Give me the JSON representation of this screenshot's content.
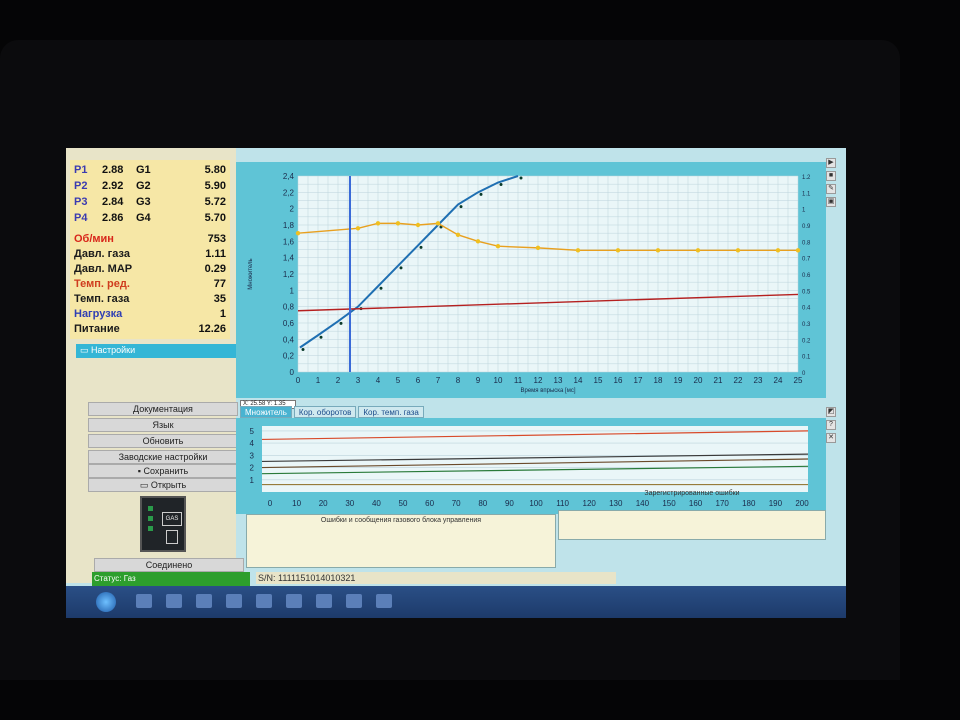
{
  "params": {
    "injectors": [
      {
        "label": "P1",
        "pressure": "2.88",
        "gas": "G1",
        "value": "5.80"
      },
      {
        "label": "P2",
        "pressure": "2.92",
        "gas": "G2",
        "value": "5.90"
      },
      {
        "label": "P3",
        "pressure": "2.84",
        "gas": "G3",
        "value": "5.72"
      },
      {
        "label": "P4",
        "pressure": "2.86",
        "gas": "G4",
        "value": "5.70"
      }
    ],
    "sensors": [
      {
        "label": "Об/мин",
        "value": "753",
        "color": "#d8261a"
      },
      {
        "label": "Давл. газа",
        "value": "1.11",
        "color": "#1b1b1b"
      },
      {
        "label": "Давл. MAP",
        "value": "0.29",
        "color": "#1b1b1b"
      },
      {
        "label": "Темп. ред.",
        "value": "77",
        "color": "#cf3d1f"
      },
      {
        "label": "Темп. газа",
        "value": "35",
        "color": "#1b1b1b"
      },
      {
        "label": "Нагрузка",
        "value": "1",
        "color": "#2f3fb3"
      },
      {
        "label": "Питание",
        "value": "12.26",
        "color": "#1b1b1b"
      }
    ]
  },
  "sidebar": {
    "settings_header": "Настройки",
    "buttons": [
      "Документация",
      "Язык",
      "Обновить",
      "Заводские настройки",
      "Сохранить",
      "Открыть"
    ],
    "device_label": "GAS",
    "connect_label": "Соединено"
  },
  "chart": {
    "coord_readout": "X: 25.58  Y: 1.35",
    "xlabel": "Время впрыска [мс]",
    "ylabel": "Множитель",
    "x_ticks": [
      "0",
      "1",
      "2",
      "3",
      "4",
      "5",
      "6",
      "7",
      "8",
      "9",
      "10",
      "11",
      "12",
      "13",
      "14",
      "15",
      "16",
      "17",
      "18",
      "19",
      "20",
      "21",
      "22",
      "23",
      "24",
      "25"
    ],
    "y_ticks": [
      "0",
      "0,2",
      "0,4",
      "0,6",
      "0,8",
      "1",
      "1,2",
      "1,4",
      "1,6",
      "1,8",
      "2",
      "2,2",
      "2,4"
    ],
    "y2_ticks": [
      "0",
      "0.1",
      "0.2",
      "0.3",
      "0.4",
      "0.5",
      "0.6",
      "0.7",
      "0.8",
      "0.9",
      "1",
      "1.1",
      "1.2"
    ]
  },
  "chart_data": {
    "type": "line",
    "xlim": [
      0,
      25
    ],
    "ylim": [
      0,
      2.4
    ],
    "series": [
      {
        "color": "#1f6fb2",
        "x": [
          0.1,
          1,
          2,
          3,
          4,
          5,
          6,
          7,
          8,
          9,
          10,
          11
        ],
        "y": [
          0.3,
          0.45,
          0.62,
          0.8,
          1.05,
          1.3,
          1.55,
          1.8,
          2.05,
          2.2,
          2.32,
          2.4
        ]
      },
      {
        "color": "#e8a020",
        "x": [
          0,
          3,
          4,
          5,
          6,
          7,
          8,
          9,
          10,
          12,
          14,
          16,
          18,
          20,
          22,
          24,
          25
        ],
        "y": [
          1.7,
          1.76,
          1.82,
          1.82,
          1.8,
          1.82,
          1.68,
          1.6,
          1.54,
          1.52,
          1.49,
          1.49,
          1.49,
          1.49,
          1.49,
          1.49,
          1.49
        ]
      },
      {
        "color": "#b52020",
        "x": [
          0,
          25
        ],
        "y": [
          0.75,
          0.95
        ]
      }
    ],
    "cursor_x": 2.6,
    "grid": true
  },
  "tabs": [
    "Множитель",
    "Кор. оборотов",
    "Кор. темп. газа"
  ],
  "lower_chart": {
    "x_ticks": [
      "0",
      "10",
      "20",
      "30",
      "40",
      "50",
      "60",
      "70",
      "80",
      "90",
      "100",
      "110",
      "120",
      "130",
      "140",
      "150",
      "160",
      "170",
      "180",
      "190",
      "200"
    ],
    "y_ticks": [
      "1",
      "2",
      "3",
      "4",
      "5"
    ],
    "lines": [
      {
        "color": "#d84a2a",
        "start": 4.3,
        "end": 5.0
      },
      {
        "color": "#3a3a3a",
        "start": 2.5,
        "end": 3.1
      },
      {
        "color": "#6a4a2a",
        "start": 2.0,
        "end": 2.7
      },
      {
        "color": "#2a7a3a",
        "start": 1.5,
        "end": 2.1
      }
    ]
  },
  "panes": {
    "errors_title": "Ошибки и сообщения газового блока управления",
    "registered_title": "Зарегистрированные ошибки"
  },
  "status": {
    "gas_status": "Статус: Газ",
    "serial": "S/N: 1111151014010321"
  },
  "right_toolbar": [
    "▶",
    "■",
    "✎",
    "▣",
    "◩",
    "?",
    "✕"
  ],
  "colors": {
    "accent": "#49b3d1",
    "chart_bg": "#eaf6f8",
    "status_green": "#2d9e2d"
  }
}
